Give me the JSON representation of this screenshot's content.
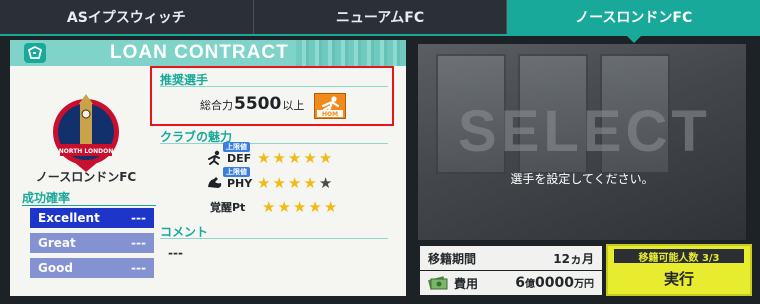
{
  "tabs": [
    {
      "label": "ASイプスウィッチ",
      "active": false
    },
    {
      "label": "ニューアムFC",
      "active": false
    },
    {
      "label": "ノースロンドンFC",
      "active": true
    }
  ],
  "card": {
    "title": "LOAN CONTRACT",
    "club_name": "ノースロンドンFC",
    "emblem_text": "NORTH LONDON",
    "success_rate": {
      "title": "成功確率",
      "rows": [
        {
          "label": "Excellent",
          "value": "---"
        },
        {
          "label": "Great",
          "value": "---"
        },
        {
          "label": "Good",
          "value": "---"
        }
      ]
    },
    "recommended": {
      "title": "推奨選手",
      "prefix": "総合力",
      "value": "5500",
      "suffix": "以上",
      "badge": "HOM"
    },
    "club_charm": {
      "title": "クラブの魅力",
      "stats": [
        {
          "label": "DEF",
          "badge": "上限値",
          "stars": 5,
          "max": 5,
          "icon": "defender-icon"
        },
        {
          "label": "PHY",
          "badge": "上限値",
          "stars": 4,
          "max": 5,
          "icon": "flex-arm-icon"
        },
        {
          "label": "覚醒Pt",
          "badge": "",
          "stars": 5,
          "max": 5,
          "icon": ""
        }
      ]
    },
    "comment": {
      "title": "コメント",
      "value": "---"
    }
  },
  "preview": {
    "big_word": "SELECT",
    "message": "選手を設定してください。"
  },
  "transfer": {
    "period_label": "移籍期間",
    "period_value": "12ヵ月",
    "cost_label": "費用",
    "cost_value_oku": "6",
    "cost_unit_oku": "億",
    "cost_value_man": "0000",
    "cost_unit_man": "万円"
  },
  "execute": {
    "count_text": "移籍可能人数 3/3",
    "button_label": "実行"
  },
  "colors": {
    "accent": "#19a99a",
    "highlight": "#e8141a",
    "execute": "#e8ec2e",
    "star": "#f0bb16"
  }
}
